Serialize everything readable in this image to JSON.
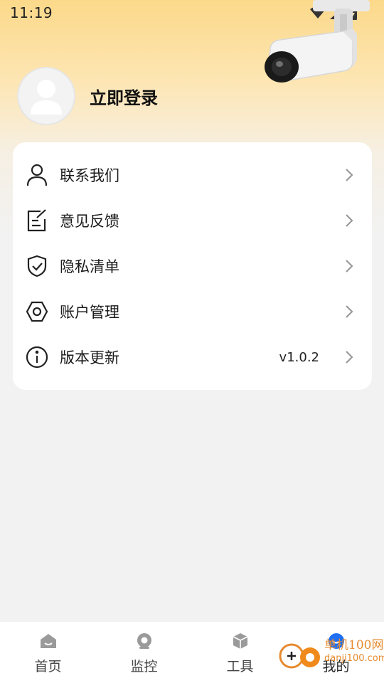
{
  "status_bar": {
    "time": "11:19"
  },
  "profile": {
    "login_label": "立即登录"
  },
  "menu": {
    "items": [
      {
        "label": "联系我们",
        "icon": "person-icon"
      },
      {
        "label": "意见反馈",
        "icon": "edit-note-icon"
      },
      {
        "label": "隐私清单",
        "icon": "shield-check-icon"
      },
      {
        "label": "账户管理",
        "icon": "hexagon-settings-icon"
      },
      {
        "label": "版本更新",
        "icon": "info-icon",
        "value": "v1.0.2"
      }
    ]
  },
  "tab_bar": {
    "tabs": [
      {
        "label": "首页",
        "icon": "home-icon"
      },
      {
        "label": "监控",
        "icon": "camera-icon"
      },
      {
        "label": "工具",
        "icon": "box-icon"
      },
      {
        "label": "我的",
        "icon": "profile-icon",
        "active": true
      }
    ]
  },
  "watermark": {
    "line1": "单机100网",
    "line2": "danji100.com"
  },
  "colors": {
    "accent": "#1e6ff1",
    "header_top": "#fcd98a",
    "watermark": "#e68a2e"
  }
}
